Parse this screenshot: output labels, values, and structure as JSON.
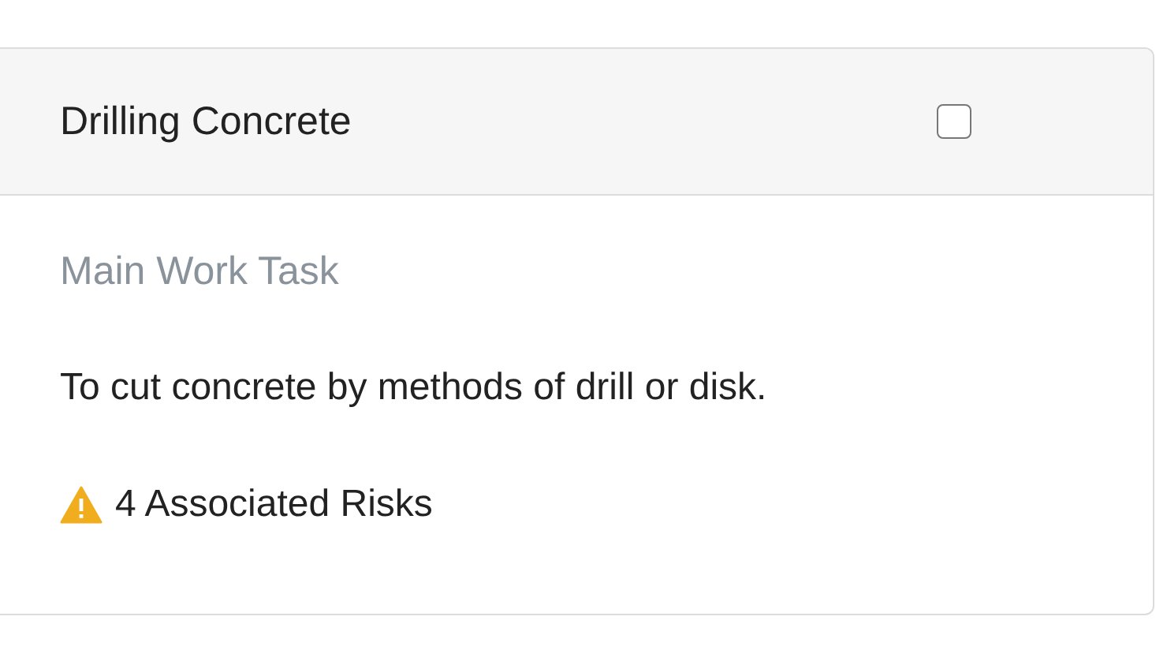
{
  "card": {
    "title": "Drilling Concrete",
    "checked": false,
    "subtitle": "Main Work Task",
    "description": "To cut concrete by methods of drill or disk.",
    "risks": "4 Associated Risks"
  }
}
